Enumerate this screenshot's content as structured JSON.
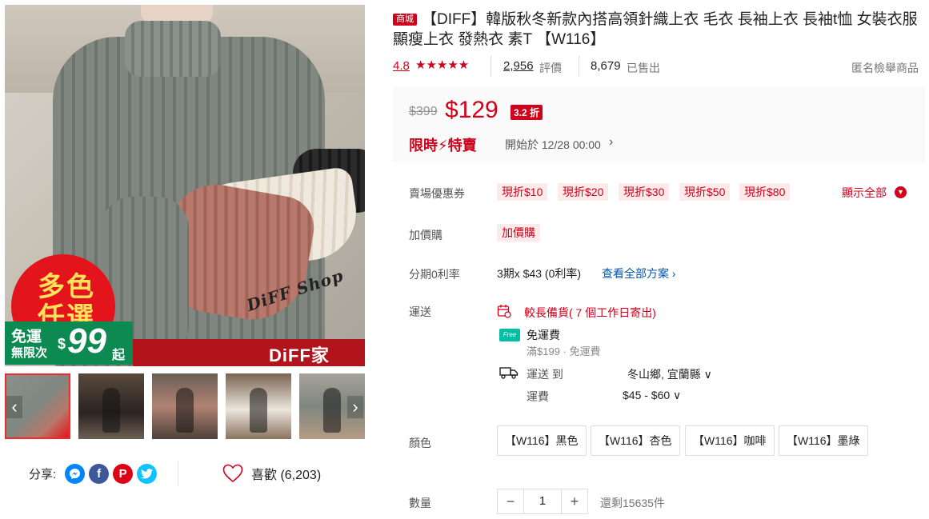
{
  "gallery": {
    "promo_circle": "多色任選",
    "promo_free_shipping": "免運",
    "promo_unlimited": "無限次",
    "promo_currency": "$",
    "promo_amount": "99",
    "promo_suffix": "起",
    "brand": "DiFF家",
    "watermark": "DiFF Shop",
    "thumbnails": [
      "thumb-1",
      "thumb-2",
      "thumb-3",
      "thumb-4",
      "thumb-5"
    ]
  },
  "share": {
    "label": "分享:",
    "networks": [
      "messenger-icon",
      "facebook-icon",
      "pinterest-icon",
      "twitter-icon"
    ]
  },
  "like": {
    "label": "喜歡 (6,203)"
  },
  "product": {
    "mall_badge": "商城",
    "title": "【DIFF】韓版秋冬新款內搭高領針織上衣 毛衣 長袖上衣 長袖t恤 女裝衣服 顯瘦上衣 發熱衣 素T 【W116】",
    "rating": "4.8",
    "stars": "★★★★★",
    "review_count": "2,956",
    "review_label": "評價",
    "sold_count": "8,679",
    "sold_label": "已售出",
    "anonymous_check": "匿名檢舉商品"
  },
  "price": {
    "original": "$399",
    "sale": "$129",
    "discount": "3.2 折",
    "flash_label_1": "限時",
    "flash_bolt": "⚡",
    "flash_label_2": "特賣",
    "start_time": "開始於 12/28 00:00",
    "chevron": "›"
  },
  "vouchers": {
    "label": "賣場優惠券",
    "items": [
      "現折$10",
      "現折$20",
      "現折$30",
      "現折$50",
      "現折$80"
    ],
    "show_all": "顯示全部"
  },
  "addon": {
    "label": "加價購",
    "tag": "加價購"
  },
  "installment": {
    "label": "分期0利率",
    "value": "3期x $43 (0利率)",
    "link": "查看全部方案 ›"
  },
  "shipping": {
    "label": "運送",
    "long_stock": "較長備貨( 7 個工作日寄出)",
    "free_icon": "Free",
    "free_title": "免運費",
    "free_sub": "滿$199 · 免運費",
    "ship_to_label": "運送 到",
    "ship_to_value": "冬山鄉, 宜蘭縣 ∨",
    "fee_label": "運費",
    "fee_value": "$45 - $60 ∨"
  },
  "colors": {
    "label": "顏色",
    "options": [
      "【W116】黑色",
      "【W116】杏色",
      "【W116】咖啡",
      "【W116】墨綠"
    ]
  },
  "quantity": {
    "label": "數量",
    "minus": "−",
    "value": "1",
    "plus": "+",
    "stock": "還剩15635件"
  },
  "colors_theme": {
    "accent": "#d0011b",
    "voucher_bg": "#fdeaea",
    "link": "#0055aa"
  }
}
